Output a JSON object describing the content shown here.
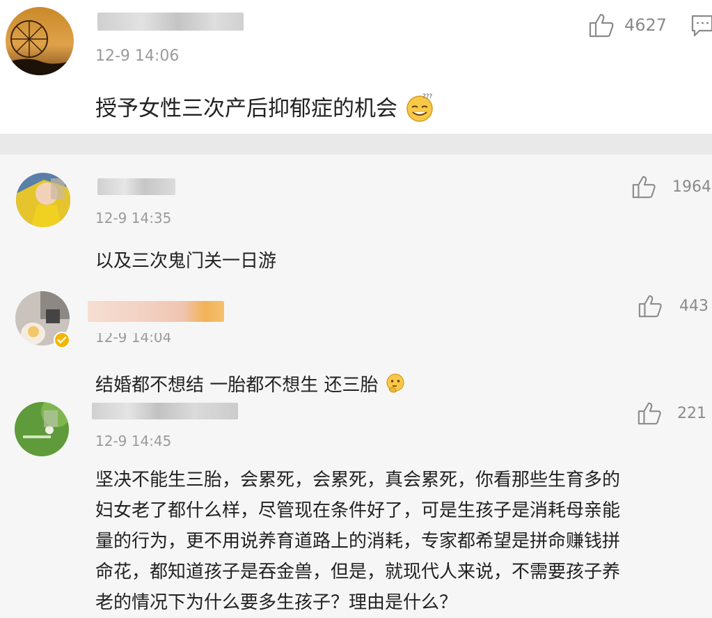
{
  "colors": {
    "timestamp": "#9a9a9a",
    "text": "#222222",
    "like": "#8a8a8a",
    "verified_badge": "#f5b400"
  },
  "main_comment": {
    "time": "12-9 14:06",
    "text": "授予女性三次产后抑郁症的机会",
    "emoji": "dizzy-smile-emoji",
    "likes": "4627"
  },
  "replies": [
    {
      "time": "12-9 14:35",
      "text": "以及三次鬼门关一日游",
      "likes": "1964"
    },
    {
      "time": "12-9 14:04",
      "text": "结婚都不想结 一胎都不想生 还三胎",
      "emoji": "thinking-emoji",
      "likes": "443",
      "verified": true
    },
    {
      "time": "12-9 14:45",
      "likes": "221",
      "lines": [
        "坚决不能生三胎，会累死，会累死，真会累死，你看那些生育多的",
        "妇女老了都什么样，尽管现在条件好了，可是生孩子是消耗母亲能",
        "量的行为，更不用说养育道路上的消耗，专家都希望是拼命赚钱拼",
        "命花，都知道孩子是吞金兽，但是，就现代人来说，不需要孩子养",
        "老的情况下为什么要多生孩子？理由是什么？"
      ]
    }
  ]
}
